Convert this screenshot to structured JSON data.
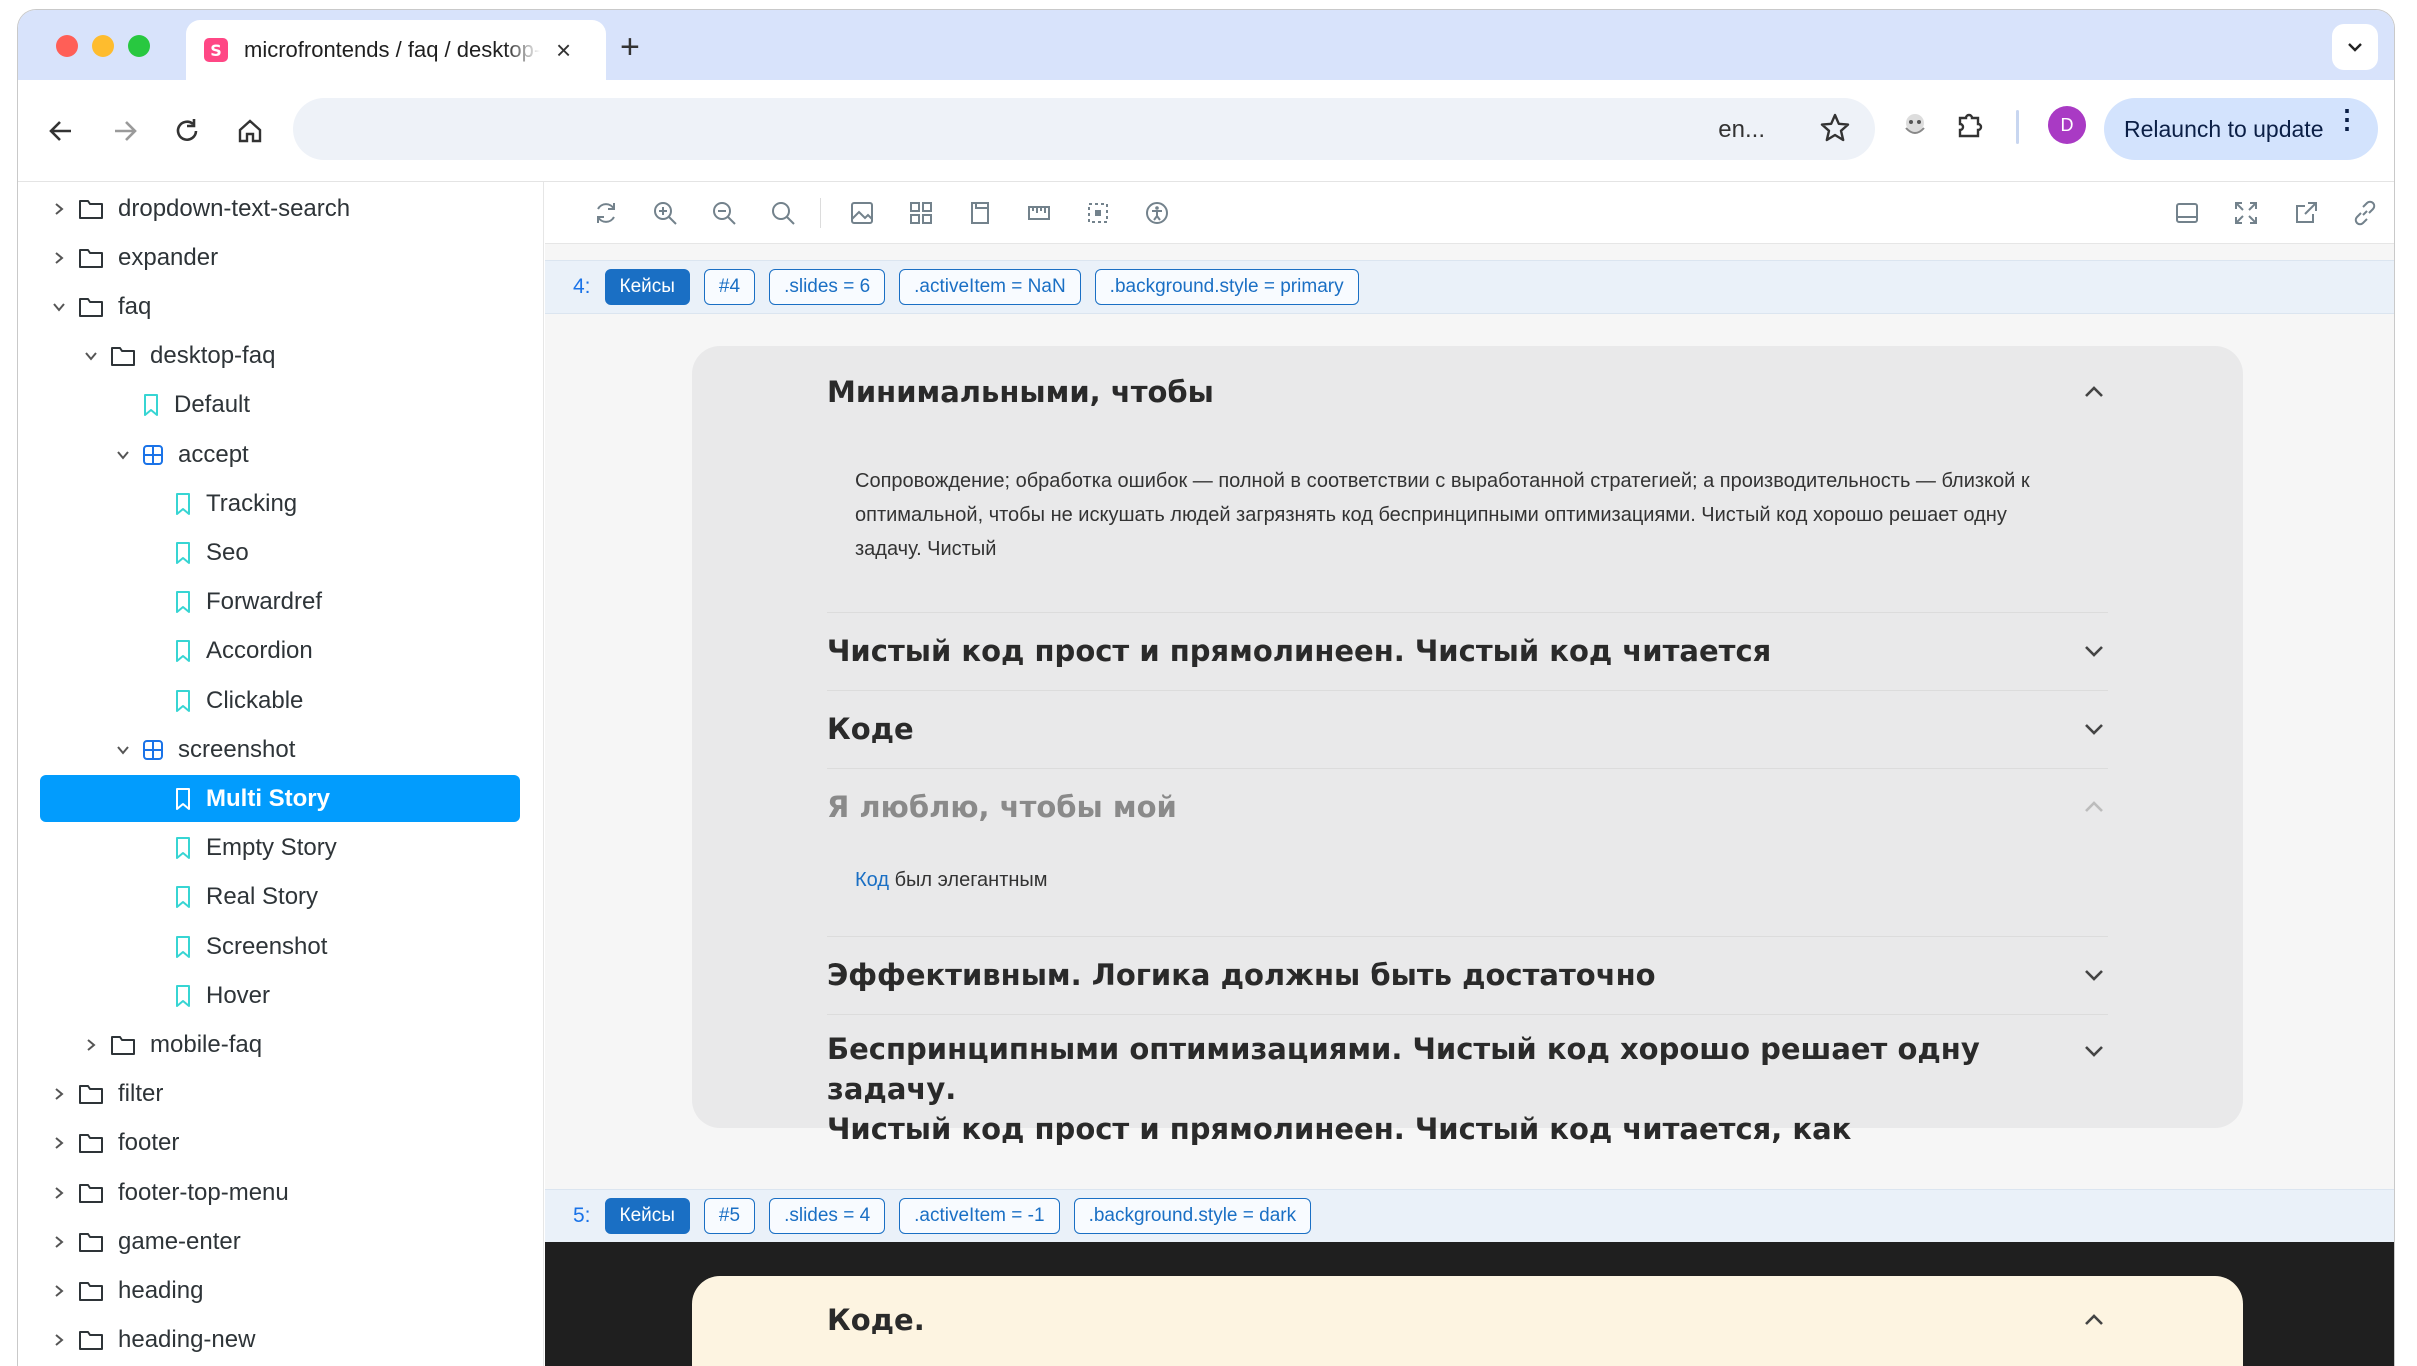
{
  "browser": {
    "tab_title": "microfrontends / faq / desktop-faq",
    "favicon_letter": "S",
    "omnibox_text": "en...",
    "profile_letter": "D",
    "relaunch_label": "Relaunch to update"
  },
  "sidebar": {
    "items": [
      {
        "label": "dropdown-text-search",
        "type": "folder",
        "expanded": false,
        "depth": 0
      },
      {
        "label": "expander",
        "type": "folder",
        "expanded": false,
        "depth": 0
      },
      {
        "label": "faq",
        "type": "folder",
        "expanded": true,
        "depth": 0
      },
      {
        "label": "desktop-faq",
        "type": "folder",
        "expanded": true,
        "depth": 1
      },
      {
        "label": "Default",
        "type": "story",
        "depth": 2
      },
      {
        "label": "accept",
        "type": "component",
        "expanded": true,
        "depth": 2
      },
      {
        "label": "Tracking",
        "type": "story",
        "depth": 3
      },
      {
        "label": "Seo",
        "type": "story",
        "depth": 3
      },
      {
        "label": "Forwardref",
        "type": "story",
        "depth": 3
      },
      {
        "label": "Accordion",
        "type": "story",
        "depth": 3
      },
      {
        "label": "Clickable",
        "type": "story",
        "depth": 3
      },
      {
        "label": "screenshot",
        "type": "component",
        "expanded": true,
        "depth": 2
      },
      {
        "label": "Multi Story",
        "type": "story",
        "depth": 3,
        "selected": true
      },
      {
        "label": "Empty Story",
        "type": "story",
        "depth": 3
      },
      {
        "label": "Real Story",
        "type": "story",
        "depth": 3
      },
      {
        "label": "Screenshot",
        "type": "story",
        "depth": 3
      },
      {
        "label": "Hover",
        "type": "story",
        "depth": 3
      },
      {
        "label": "mobile-faq",
        "type": "folder",
        "expanded": false,
        "depth": 1
      },
      {
        "label": "filter",
        "type": "folder",
        "expanded": false,
        "depth": 0
      },
      {
        "label": "footer",
        "type": "folder",
        "expanded": false,
        "depth": 0
      },
      {
        "label": "footer-top-menu",
        "type": "folder",
        "expanded": false,
        "depth": 0
      },
      {
        "label": "game-enter",
        "type": "folder",
        "expanded": false,
        "depth": 0
      },
      {
        "label": "heading",
        "type": "folder",
        "expanded": false,
        "depth": 0
      },
      {
        "label": "heading-new",
        "type": "folder",
        "expanded": false,
        "depth": 0
      }
    ]
  },
  "cases": [
    {
      "num": "4:",
      "tag": "Кейсы",
      "id": "#4",
      "slides": ".slides = 6",
      "active": ".activeItem = NaN",
      "bg": ".background.style = primary"
    },
    {
      "num": "5:",
      "tag": "Кейсы",
      "id": "#5",
      "slides": ".slides = 4",
      "active": ".activeItem = -1",
      "bg": ".background.style = dark"
    }
  ],
  "faq1": {
    "q1": "Минимальными, чтобы",
    "a1": "Сопровождение; обработка ошибок — полной в соответствии с выработанной стратегией; а производительность — близкой к оптимальной, чтобы не искушать людей загрязнять код беспринципными оптимизациями. Чистый код хорошо решает одну задачу. Чистый",
    "q2": "Чистый код прост и прямолинеен. Чистый код читается",
    "q3": "Коде",
    "q4": "Я люблю, чтобы мой",
    "a4_link": "Код",
    "a4_rest": " был элегантным",
    "q5": "Эффективным. Логика должны быть достаточно",
    "q6_line1": "Беспринципными оптимизациями. Чистый код хорошо решает одну задачу.",
    "q6_line2": "Чистый код прост и прямолинеен. Чистый код читается, как"
  },
  "faq2": {
    "q1": "Коде."
  }
}
